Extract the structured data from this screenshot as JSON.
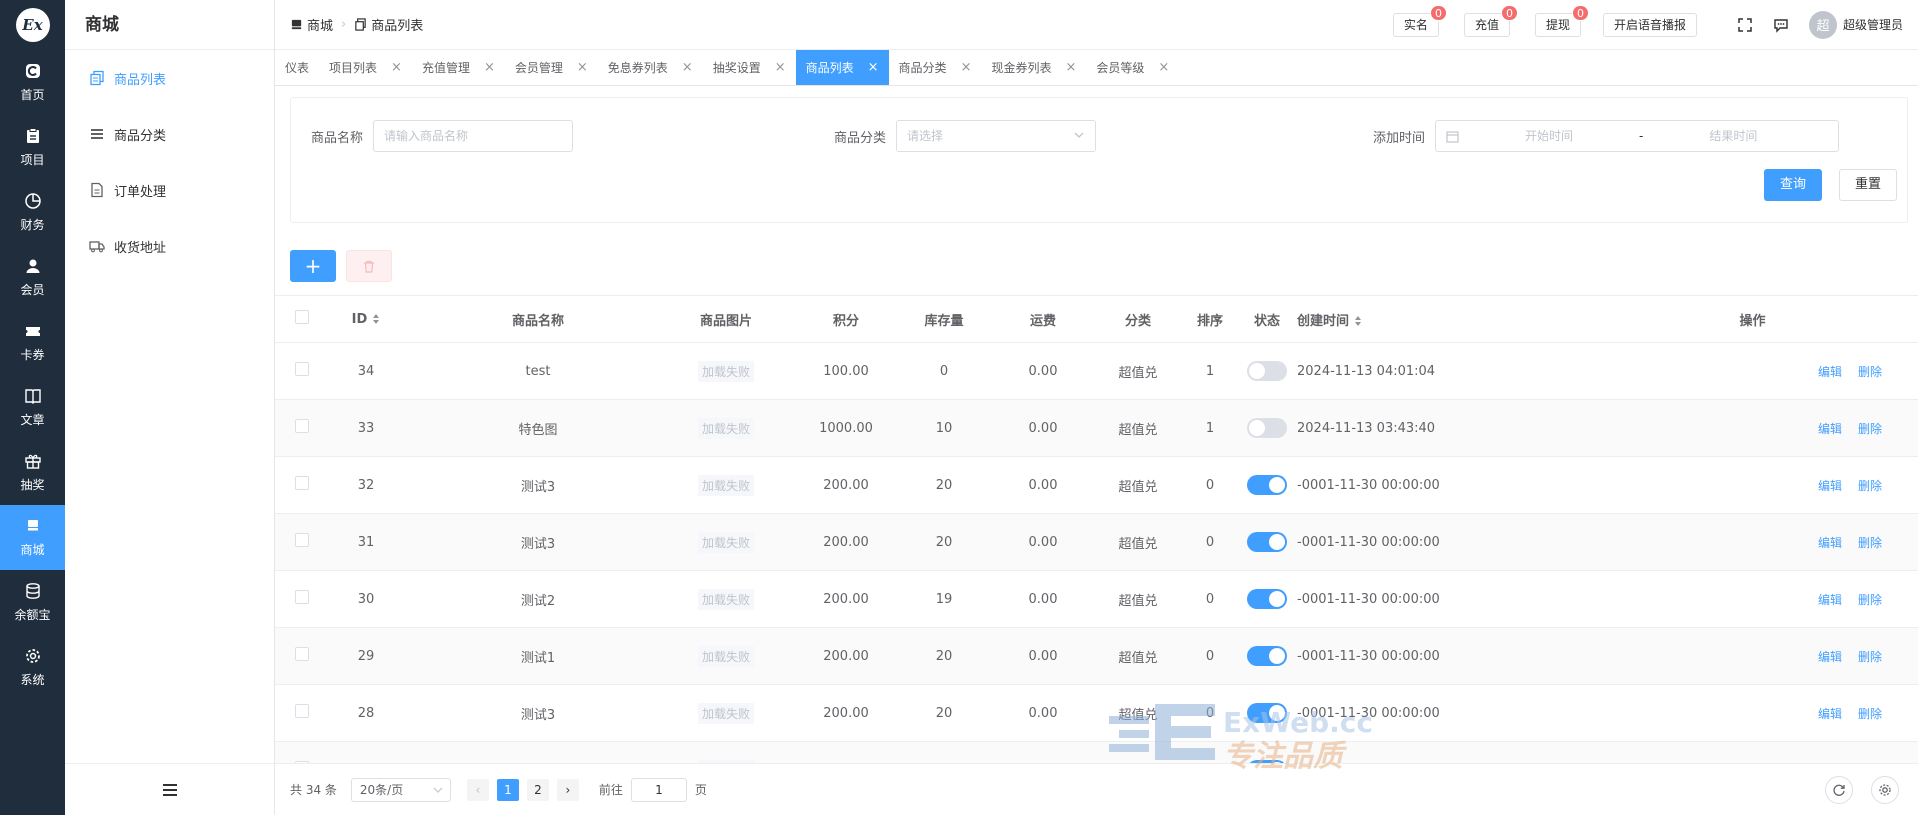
{
  "app": {
    "logo_text": "Ex",
    "module_title": "商城"
  },
  "rail": [
    {
      "label": "首页",
      "icon": "home-icon"
    },
    {
      "label": "项目",
      "icon": "project-icon"
    },
    {
      "label": "财务",
      "icon": "finance-icon"
    },
    {
      "label": "会员",
      "icon": "member-icon"
    },
    {
      "label": "卡券",
      "icon": "ticket-icon"
    },
    {
      "label": "文章",
      "icon": "book-icon"
    },
    {
      "label": "抽奖",
      "icon": "gift-icon"
    },
    {
      "label": "商城",
      "icon": "store-icon",
      "active": true
    },
    {
      "label": "余额宝",
      "icon": "database-icon"
    },
    {
      "label": "系统",
      "icon": "settings-icon"
    }
  ],
  "submenu": [
    {
      "label": "商品列表",
      "icon": "copy-icon",
      "active": true
    },
    {
      "label": "商品分类",
      "icon": "list-icon"
    },
    {
      "label": "订单处理",
      "icon": "document-icon"
    },
    {
      "label": "收货地址",
      "icon": "truck-icon"
    }
  ],
  "breadcrumb": {
    "root": "商城",
    "current": "商品列表"
  },
  "topbar": {
    "buttons": [
      {
        "label": "实名",
        "badge": "0"
      },
      {
        "label": "充值",
        "badge": "0"
      },
      {
        "label": "提现",
        "badge": "0"
      }
    ],
    "voice_label": "开启语音播报",
    "avatar_text": "超",
    "user_name": "超级管理员"
  },
  "tabs": [
    {
      "label": "仪表",
      "closable": false
    },
    {
      "label": "项目列表",
      "closable": true
    },
    {
      "label": "充值管理",
      "closable": true
    },
    {
      "label": "会员管理",
      "closable": true
    },
    {
      "label": "免息券列表",
      "closable": true
    },
    {
      "label": "抽奖设置",
      "closable": true
    },
    {
      "label": "商品列表",
      "closable": true,
      "active": true
    },
    {
      "label": "商品分类",
      "closable": true
    },
    {
      "label": "现金券列表",
      "closable": true
    },
    {
      "label": "会员等级",
      "closable": true
    }
  ],
  "search": {
    "name_label": "商品名称",
    "name_placeholder": "请输入商品名称",
    "category_label": "商品分类",
    "category_placeholder": "请选择",
    "time_label": "添加时间",
    "start_placeholder": "开始时间",
    "range_sep": "-",
    "end_placeholder": "结果时间",
    "query_label": "查询",
    "reset_label": "重置"
  },
  "toolbar": {
    "add_symbol": "+"
  },
  "table": {
    "columns": [
      "ID",
      "商品名称",
      "商品图片",
      "积分",
      "库存量",
      "运费",
      "分类",
      "排序",
      "状态",
      "创建时间",
      "操作"
    ],
    "edit_label": "编辑",
    "delete_label": "删除",
    "rows": [
      {
        "id": "34",
        "name": "test",
        "img": "加载失败",
        "points": "100.00",
        "stock": "0",
        "shipping": "0.00",
        "category": "超值兑",
        "sort": "1",
        "status": false,
        "created": "2024-11-13 04:01:04"
      },
      {
        "id": "33",
        "name": "特色图",
        "img": "加载失败",
        "points": "1000.00",
        "stock": "10",
        "shipping": "0.00",
        "category": "超值兑",
        "sort": "1",
        "status": false,
        "created": "2024-11-13 03:43:40"
      },
      {
        "id": "32",
        "name": "测试3",
        "img": "加载失败",
        "points": "200.00",
        "stock": "20",
        "shipping": "0.00",
        "category": "超值兑",
        "sort": "0",
        "status": true,
        "created": "-0001-11-30 00:00:00"
      },
      {
        "id": "31",
        "name": "测试3",
        "img": "加载失败",
        "points": "200.00",
        "stock": "20",
        "shipping": "0.00",
        "category": "超值兑",
        "sort": "0",
        "status": true,
        "created": "-0001-11-30 00:00:00"
      },
      {
        "id": "30",
        "name": "测试2",
        "img": "加载失败",
        "points": "200.00",
        "stock": "19",
        "shipping": "0.00",
        "category": "超值兑",
        "sort": "0",
        "status": true,
        "created": "-0001-11-30 00:00:00"
      },
      {
        "id": "29",
        "name": "测试1",
        "img": "加载失败",
        "points": "200.00",
        "stock": "20",
        "shipping": "0.00",
        "category": "超值兑",
        "sort": "0",
        "status": true,
        "created": "-0001-11-30 00:00:00"
      },
      {
        "id": "28",
        "name": "测试3",
        "img": "加载失败",
        "points": "200.00",
        "stock": "20",
        "shipping": "0.00",
        "category": "超值兑",
        "sort": "0",
        "status": true,
        "created": "-0001-11-30 00:00:00"
      },
      {
        "id": "",
        "name": "",
        "img": "加载失败",
        "points": "",
        "stock": "",
        "shipping": "",
        "category": "",
        "sort": "",
        "status": true,
        "created": ""
      }
    ]
  },
  "pager": {
    "total": "共 34 条",
    "page_size": "20条/页",
    "pages": [
      "1",
      "2"
    ],
    "current": "1",
    "goto_prefix": "前往",
    "goto_value": "1",
    "goto_suffix": "页"
  },
  "watermark": {
    "line1": "ExWeb.cc",
    "line2": "专注品质"
  }
}
